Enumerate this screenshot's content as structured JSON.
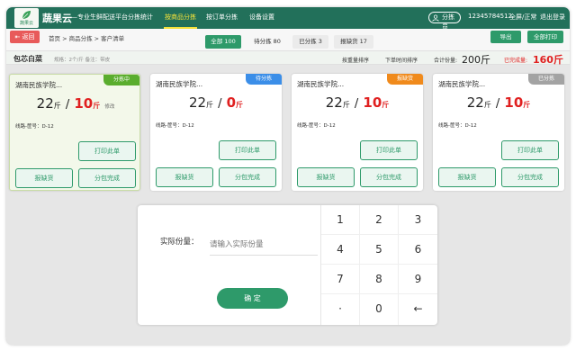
{
  "header": {
    "logo_text": "蔬果云",
    "brand": "蔬果云",
    "brand_sub": "—专业生鲜配送平台",
    "nav": [
      "分拣统计",
      "按商品分拣",
      "按订单分拣",
      "设备设置"
    ],
    "active_nav": "按商品分拣",
    "role": "分拣员",
    "phone": "12345784512",
    "mode": "全屏/正常",
    "logout": "退出登录"
  },
  "toolbar": {
    "back_label": "返回",
    "breadcrumb": "首页 > 商品分拣 > 客户清单",
    "tabs": [
      {
        "label": "全部 100",
        "active": true
      },
      {
        "label": "待分拣 80",
        "active": false
      },
      {
        "label": "已分拣 3",
        "active": false
      },
      {
        "label": "报缺货 17",
        "active": false
      }
    ],
    "export_label": "导出",
    "print_all_label": "全部打印"
  },
  "product": {
    "name": "包芯白菜",
    "spec": "规格：2个/斤   备注：带皮",
    "sort_by_qty": "按重量排序",
    "sort_by_time": "下单时间排序",
    "total_label": "合计份量:",
    "total_value": "200斤",
    "done_label": "已完成量:",
    "done_value": "160斤"
  },
  "cards": [
    {
      "title": "湖南民族学院...",
      "badge": "分拣中",
      "badge_color": "#5aad2e",
      "order_qty": "22",
      "actual_qty": "10",
      "unit": "斤",
      "modify": "修改",
      "route": "线路-筐号：D-12",
      "print_label": "打印此单",
      "shortage_label": "报缺货",
      "split_label": "分包完成",
      "selected": true
    },
    {
      "title": "湖南民族学院...",
      "badge": "待分拣",
      "badge_color": "#3b8ee8",
      "order_qty": "22",
      "actual_qty": "0",
      "unit": "斤",
      "modify": "",
      "route": "线路-筐号：D-12",
      "print_label": "打印此单",
      "shortage_label": "报缺货",
      "split_label": "分包完成",
      "selected": false
    },
    {
      "title": "湖南民族学院...",
      "badge": "报缺货",
      "badge_color": "#f08a1c",
      "order_qty": "22",
      "actual_qty": "10",
      "unit": "斤",
      "modify": "",
      "route": "线路-筐号：D-12",
      "print_label": "打印此单",
      "shortage_label": "报缺货",
      "split_label": "分包完成",
      "selected": false
    },
    {
      "title": "湖南民族学院...",
      "badge": "已分拣",
      "badge_color": "#a3a3a3",
      "order_qty": "22",
      "actual_qty": "10",
      "unit": "斤",
      "modify": "",
      "route": "线路-筐号：D-12",
      "print_label": "打印此单",
      "shortage_label": "报缺货",
      "split_label": "分包完成",
      "selected": false
    }
  ],
  "entry": {
    "label": "实际份量：",
    "placeholder": "请输入实际份量",
    "confirm_label": "确 定"
  },
  "keypad": [
    "1",
    "2",
    "3",
    "4",
    "5",
    "6",
    "7",
    "8",
    "9",
    "·",
    "0",
    "←"
  ],
  "colors": {
    "primary_green": "#2e9a6a",
    "header_green": "#22705a",
    "alert_red": "#e02020"
  }
}
